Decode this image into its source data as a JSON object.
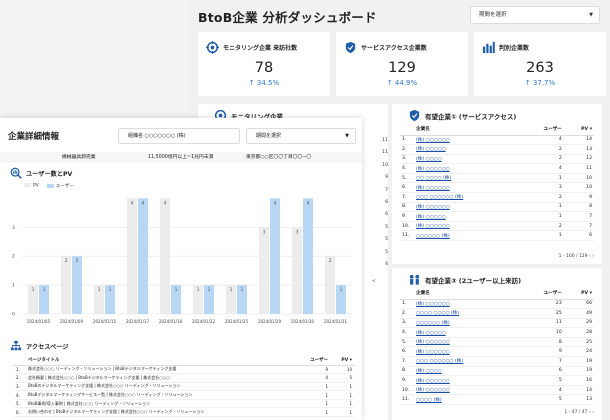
{
  "dashboard": {
    "title": "BtoB企業 分析ダッシュボード",
    "period_placeholder": "期間を選択",
    "kpis": [
      {
        "label": "モニタリング企業 来訪社数",
        "value": "78",
        "delta": "↑ 34.5%"
      },
      {
        "label": "サービスアクセス企業数",
        "value": "129",
        "delta": "↑ 44.9%"
      },
      {
        "label": "判別企業数",
        "value": "263",
        "delta": "↑ 37.7%"
      }
    ],
    "monitoring": {
      "title": "モニタリング企業",
      "partial_rows": [
        "1",
        "1",
        "1",
        "1",
        "1",
        "1"
      ],
      "pager_partial": "<"
    },
    "prospect1": {
      "title": "有望企業① (サービスアクセス)",
      "headers": {
        "company": "企業名",
        "users": "ユーザー",
        "pv": "PV ▾"
      },
      "rows": [
        {
          "no": "1.",
          "name": "(株) ○○○○○○",
          "users": "4",
          "pv": "14"
        },
        {
          "no": "2.",
          "name": "(株) ○○○○○",
          "users": "2",
          "pv": "13"
        },
        {
          "no": "3.",
          "name": "(株) ○○○○",
          "users": "2",
          "pv": "12"
        },
        {
          "no": "4.",
          "name": "(株) ○○○○○○",
          "users": "4",
          "pv": "11"
        },
        {
          "no": "5.",
          "name": "○○ ○○○○ (株)",
          "users": "1",
          "pv": "10"
        },
        {
          "no": "6.",
          "name": "(株) ○○○○○○",
          "users": "3",
          "pv": "10"
        },
        {
          "no": "7.",
          "name": "○○○ ○○○○○○ (株)",
          "users": "2",
          "pv": "9"
        },
        {
          "no": "8.",
          "name": "(株) ○○○○○○",
          "users": "1",
          "pv": "8"
        },
        {
          "no": "9.",
          "name": "(株) ○○○○○",
          "users": "1",
          "pv": "7"
        },
        {
          "no": "10.",
          "name": "(株) ○○○○○○",
          "users": "2",
          "pv": "7"
        },
        {
          "no": "11.",
          "name": "○○○○○○ (株)",
          "users": "1",
          "pv": "6"
        }
      ],
      "pager": "1 - 100 / 129 ‹ ›"
    },
    "prospect3": {
      "title": "有望企業③ (2ユーザー以上来訪)",
      "headers": {
        "company": "企業名",
        "users": "ユーザー",
        "pv": "PV ▾"
      },
      "rows": [
        {
          "no": "1.",
          "name": "(株) ○○○○○○",
          "users": "23",
          "pv": "66"
        },
        {
          "no": "2.",
          "name": "○○○○ ○○○○ (株)",
          "users": "25",
          "pv": "49"
        },
        {
          "no": "3.",
          "name": "○○○○○○ (株)",
          "users": "11",
          "pv": "29"
        },
        {
          "no": "4.",
          "name": "(株) ○○○○○",
          "users": "10",
          "pv": "28"
        },
        {
          "no": "5.",
          "name": "(株) ○○○○○○",
          "users": "8",
          "pv": "25"
        },
        {
          "no": "6.",
          "name": "(株) ○○○○○○",
          "users": "9",
          "pv": "24"
        },
        {
          "no": "7.",
          "name": "○○○ ○○○○○○ (株)",
          "users": "7",
          "pv": "19"
        },
        {
          "no": "8.",
          "name": "(株) ○○○○",
          "users": "6",
          "pv": "19"
        },
        {
          "no": "9.",
          "name": "(株) ○○○○○○",
          "users": "5",
          "pv": "16"
        },
        {
          "no": "10.",
          "name": "(株) ○○○○○○",
          "users": "4",
          "pv": "14"
        },
        {
          "no": "11.",
          "name": "○○○○ (株)",
          "users": "5",
          "pv": "13"
        }
      ],
      "pager": "1 - 47 / 47 ‹ ›"
    },
    "left_partial_values": [
      "11",
      "11",
      "10",
      "9",
      "7",
      "6",
      "6",
      "5",
      "5",
      "5",
      "4"
    ]
  },
  "detail": {
    "title": "企業詳細情報",
    "company_field": "組織名 ○○○○○○○ (株)",
    "period_placeholder": "期間を選択",
    "info": {
      "industry": "機械器具卸売業",
      "scale": "11,5000億円以上~1兆円未満",
      "address": "東京都○○区〇〇丁目〇〇−〇"
    },
    "chart_title": "ユーザー数とPV",
    "access_title": "アクセスページ",
    "access_headers": {
      "page": "ページタイトル",
      "users": "ユーザー",
      "pv": "PV ▾"
    },
    "access_rows": [
      {
        "no": "1.",
        "title": "株式会社○○○ リーディング・ソリューション | BtoBデジタルマーケティング支援",
        "users": "9",
        "pv": "10"
      },
      {
        "no": "2.",
        "title": "会社概要 | 株式会社○○○ | BtoBデジタルマーケティング支援 | 株式会社○○○",
        "users": "4",
        "pv": "5"
      },
      {
        "no": "3.",
        "title": "BtoBのデジタルマーケティング支援 | 株式会社○○○ リーディング・ソリューション",
        "users": "1",
        "pv": "1"
      },
      {
        "no": "4.",
        "title": "BtoBデジタルマーケティングサービス一覧 | 株式会社○○○ リーディング・ソリューション",
        "users": "1",
        "pv": "1"
      },
      {
        "no": "5.",
        "title": "BtoB事例/導入事例 | 株式会社○○○ リーディング・ソリューション",
        "users": "1",
        "pv": "1"
      },
      {
        "no": "6.",
        "title": "お問い合わせ | BtoBデジタルマーケティング支援 | 株式会社○○○ リーディング・ソリューション",
        "users": "1",
        "pv": "1"
      }
    ]
  },
  "chart_data": {
    "type": "bar",
    "title": "ユーザー数とPV",
    "categories": [
      "2024/01/05",
      "2024/01/09",
      "2024/01/15",
      "2024/01/17",
      "2024/01/18",
      "2024/01/22",
      "2024/01/25",
      "2024/01/29",
      "2024/01/30",
      "2024/01/31"
    ],
    "series": [
      {
        "name": "PV",
        "values": [
          1,
          2,
          1,
          4,
          4,
          1,
          1,
          3,
          3,
          2
        ],
        "color": "#ececec"
      },
      {
        "name": "ユーザー",
        "values": [
          1,
          2,
          1,
          4,
          1,
          1,
          1,
          4,
          4,
          1
        ],
        "color": "#b7d7f5"
      }
    ],
    "yticks": [
      0,
      1,
      2,
      3
    ],
    "ylim": [
      0,
      4.15
    ],
    "legend": "top-left",
    "grid": true
  }
}
